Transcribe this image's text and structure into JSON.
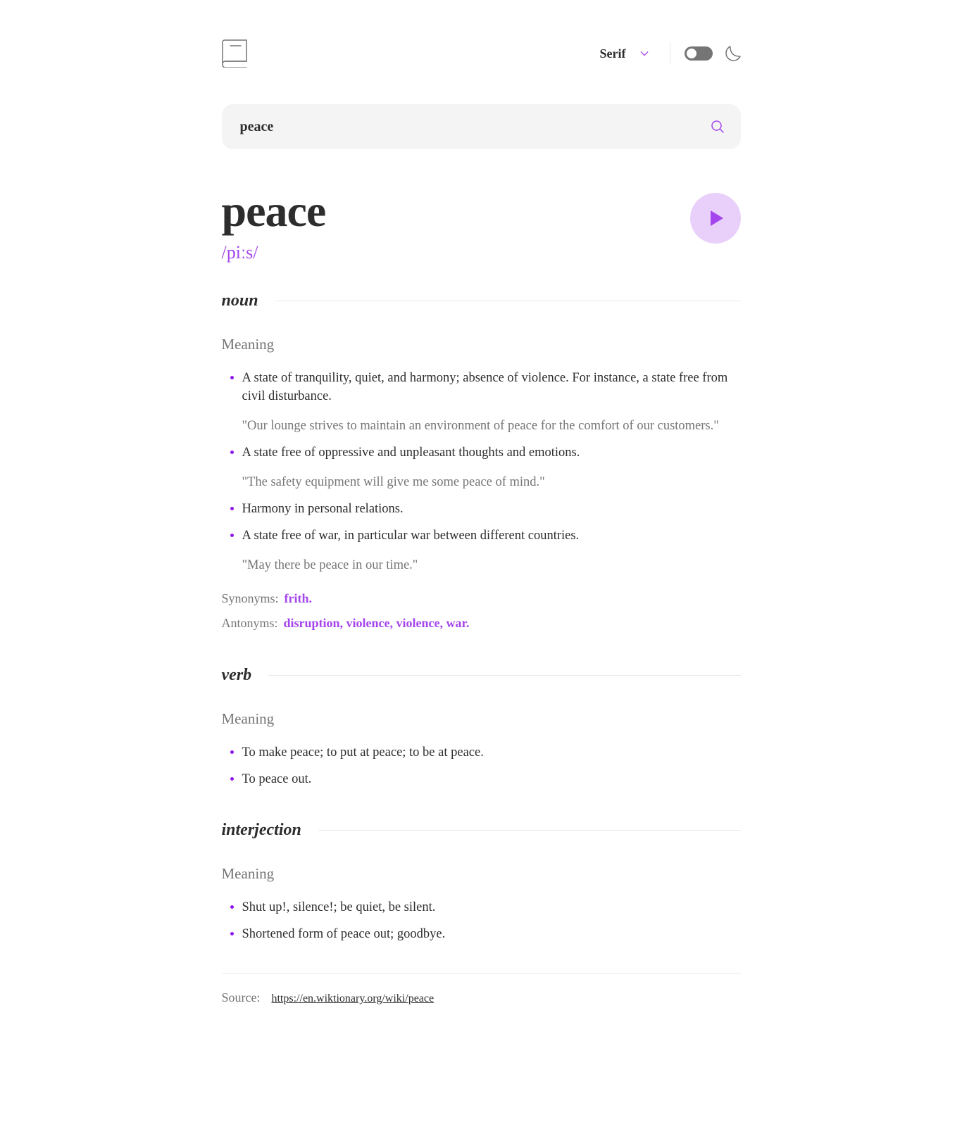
{
  "header": {
    "logo_icon": "book-icon",
    "font_selector": {
      "selected": "Serif",
      "icon": "chevron-down-icon"
    },
    "theme_toggle": {
      "state": "off",
      "icon": "moon-icon"
    }
  },
  "search": {
    "value": "peace",
    "icon": "search-icon"
  },
  "entry": {
    "word": "peace",
    "phonetic": "/piːs/",
    "play_icon": "play-icon",
    "noun": {
      "label": "noun",
      "meaning_label": "Meaning",
      "definitions": [
        {
          "text": "A state of tranquility, quiet, and harmony; absence of violence. For instance, a state free from civil disturbance.",
          "example": "\"Our lounge strives to maintain an environment of peace for the comfort of our customers.\""
        },
        {
          "text": "A state free of oppressive and unpleasant thoughts and emotions.",
          "example": "\"The safety equipment will give me some peace of mind.\""
        },
        {
          "text": "Harmony in personal relations."
        },
        {
          "text": "A state free of war, in particular war between different countries.",
          "example": "\"May there be peace in our time.\""
        }
      ],
      "synonyms_label": "Synonyms:",
      "synonyms": "frith.",
      "antonyms_label": "Antonyms:",
      "antonyms": "disruption, violence, violence, war."
    },
    "verb": {
      "label": "verb",
      "meaning_label": "Meaning",
      "definitions": [
        {
          "text": "To make peace; to put at peace; to be at peace."
        },
        {
          "text": "To peace out."
        }
      ]
    },
    "interjection": {
      "label": "interjection",
      "meaning_label": "Meaning",
      "definitions": [
        {
          "text": "Shut up!, silence!; be quiet, be silent."
        },
        {
          "text": "Shortened form of peace out; goodbye."
        }
      ]
    }
  },
  "footer": {
    "source_label": "Source:",
    "source_url": "https://en.wiktionary.org/wiki/peace"
  },
  "colors": {
    "accent": "#a445ed",
    "bullet": "#8f19e8",
    "muted": "#757575",
    "text": "#2d2d2d"
  }
}
